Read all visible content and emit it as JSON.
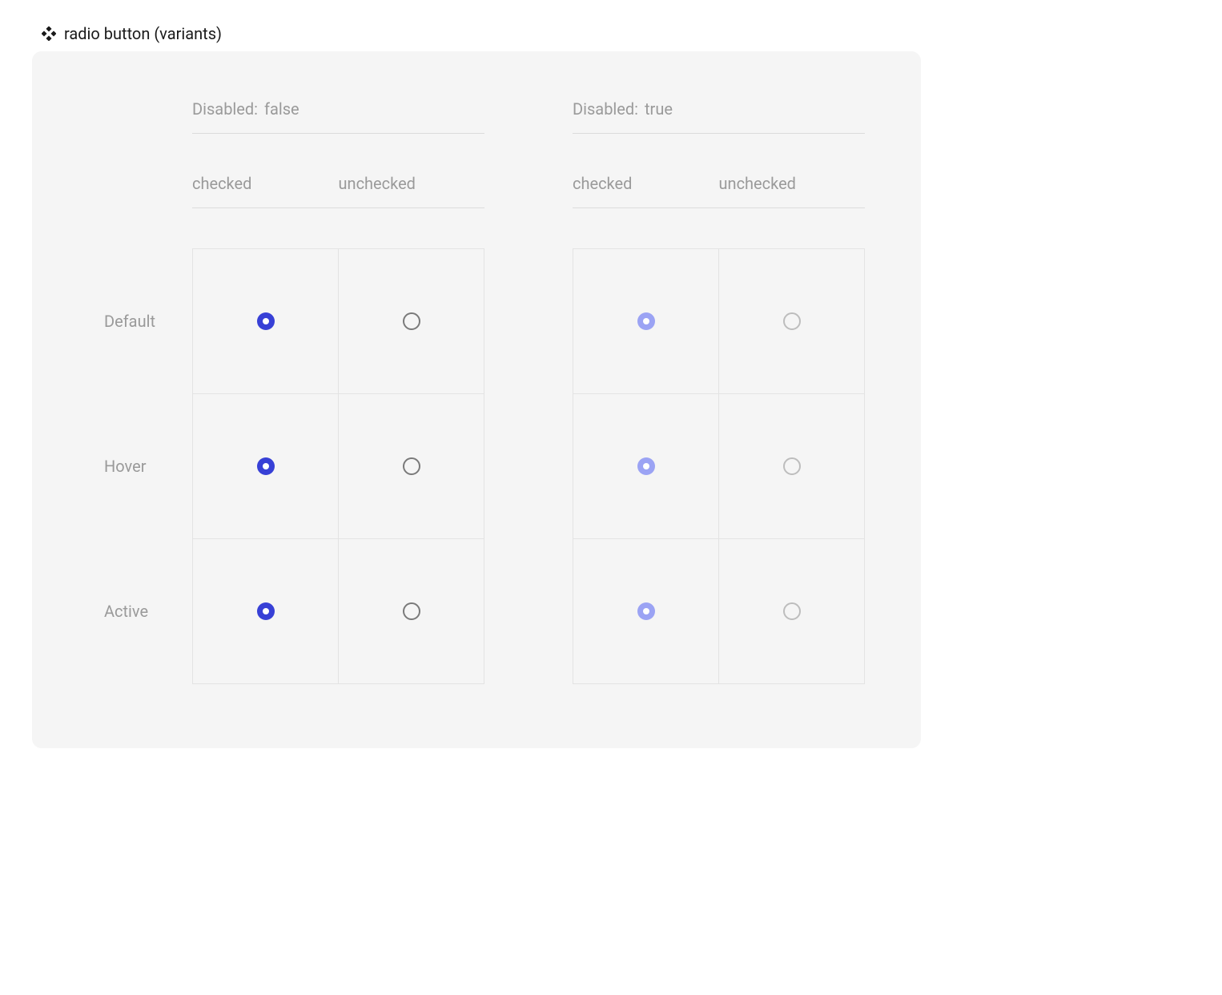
{
  "title": "radio button (variants)",
  "groups": [
    {
      "disabled_label": "Disabled:",
      "disabled_value": "false"
    },
    {
      "disabled_label": "Disabled:",
      "disabled_value": "true"
    }
  ],
  "columns": {
    "checked": "checked",
    "unchecked": "unchecked"
  },
  "rows": {
    "default": "Default",
    "hover": "Hover",
    "active": "Active"
  },
  "colors": {
    "accent": "#3740d6",
    "accent_disabled": "#9ba3f4",
    "border": "#7a7a7a",
    "border_disabled": "#bdbdbd"
  }
}
